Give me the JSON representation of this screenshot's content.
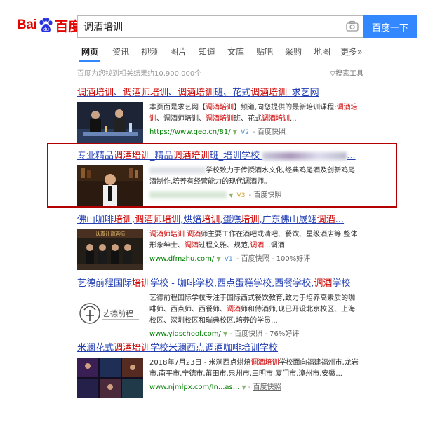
{
  "logo": {
    "bai": "Bai",
    "du": "百度"
  },
  "search": {
    "query": "调酒培训",
    "button": "百度一下"
  },
  "tabs": [
    "网页",
    "资讯",
    "视频",
    "图片",
    "知道",
    "文库",
    "贴吧",
    "采购",
    "地图",
    "更多»"
  ],
  "meta": {
    "result_count": "百度为您找到相关结果约10,900,000个",
    "tools": "搜索工具"
  },
  "results": [
    {
      "title_parts": [
        "调酒培训",
        "、",
        "调酒师培训",
        "、",
        "调酒培训",
        "班、花式",
        "调酒培训",
        "_求艺网"
      ],
      "snippet_parts": [
        "本页面是求艺网【",
        "调酒培训",
        "】频道,向您提供的最新培训课程:",
        "调酒培训",
        "、调酒师培训、",
        "调酒培训",
        "班、花式",
        "调酒培训",
        "..."
      ],
      "url": "https://www.qeo.cn/81/",
      "badge": "V2",
      "snap": "百度快照"
    },
    {
      "title_parts": [
        "专业精品",
        "调酒培训",
        "_精品",
        "调酒培训",
        "班_培训学校"
      ],
      "snippet_parts": [
        "学校致力于传授酒水文化,经典鸡尾酒及创新鸡尾酒制作,培养有经营能力的现代调酒师。"
      ],
      "badge": "V3",
      "snap": "百度快照"
    },
    {
      "title_parts": [
        "佛山咖啡",
        "培训",
        ",",
        "调酒师培训",
        ",烘焙",
        "培训",
        ",蛋糕",
        "培训",
        ",广东佛山晟翊",
        "调酒",
        "..."
      ],
      "snippet_parts": [
        "调酒师培训",
        " ",
        "调酒",
        "师主要工作在酒吧或清吧、餐饮、星级酒店等.整体形象绅士、",
        "调酒",
        "过程文雅、规范,",
        "调酒",
        "调酒"
      ],
      "url": "www.dfmzhu.com/",
      "badge": "V1",
      "snap": "百度快照",
      "rating": "100%好评",
      "thumb_caption": "认真计调酒师"
    },
    {
      "title_parts": [
        "艺德前程国际",
        "培训",
        "学校 - 咖啡学校,西点蛋糕学校,西餐学校,",
        "调酒",
        "学校"
      ],
      "snippet_parts": [
        "艺德前程国际学校专注于国际西式餐饮教育,致力于培养高素质的咖啡师、西点师、西餐师、",
        "调酒",
        "师和侍酒师,现已开设北京校区、上海校区、深圳校区和瑞典校区,培养的学员..."
      ],
      "url": "www.yidschool.com/",
      "snap": "百度快照",
      "rating": "76%好评",
      "logo_text": "艺德前程"
    },
    {
      "title_parts": [
        "米澜花式",
        "调酒培训",
        "学校米澜西点调酒咖啡培训学校"
      ],
      "snippet_parts": [
        "2018年7月23日 - 米澜西点烘焙",
        "调酒培训",
        "学校面向福建福州市,龙岩市,南平市,宁德市,莆田市,泉州市,三明市,厦门市,漳州市,安徽..."
      ],
      "url": "www.njmlpx.com/In...as...",
      "snap": "百度快照"
    }
  ]
}
